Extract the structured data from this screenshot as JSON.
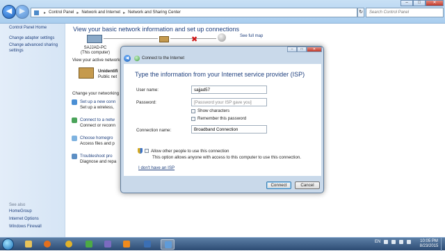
{
  "window": {
    "breadcrumb": [
      "Control Panel",
      "Network and Internet",
      "Network and Sharing Center"
    ],
    "search_placeholder": "Search Control Panel"
  },
  "left_nav": {
    "home": "Control Panel Home",
    "links": [
      "Change adapter settings",
      "Change advanced sharing settings"
    ],
    "see_also_header": "See also",
    "see_also": [
      "HomeGroup",
      "Internet Options",
      "Windows Firewall"
    ]
  },
  "main": {
    "title": "View your basic network information and set up connections",
    "computer_name": "SAJJAD-PC",
    "computer_sub": "(This computer)",
    "see_full_map": "See full map",
    "active_networks_header": "View your active networks",
    "active_network_name": "Unidentifi",
    "active_network_type": "Public net",
    "change_settings_header": "Change your networking se",
    "tasks": [
      {
        "link": "Set up a new conn",
        "desc": "Set up a wireless,"
      },
      {
        "link": "Connect to a netw",
        "desc": "Connect or reconn"
      },
      {
        "link": "Choose homegro",
        "desc": "Access files and p"
      },
      {
        "link": "Troubleshoot pro",
        "desc": "Diagnose and repa"
      }
    ]
  },
  "dialog": {
    "title": "Connect to the Internet",
    "heading": "Type the information from your Internet service provider (ISP)",
    "user_name_label": "User name:",
    "user_name_value": "sajjad57",
    "password_label": "Password:",
    "password_placeholder": "[Password your ISP gave you]",
    "show_characters": "Show characters",
    "remember_password": "Remember this password",
    "connection_name_label": "Connection name:",
    "connection_name_value": "Broadband Connection",
    "allow_others": "Allow other people to use this connection",
    "allow_desc": "This option allows anyone with access to this computer to use this connection.",
    "no_isp_link": "I don't have an ISP",
    "connect_button": "Connect",
    "cancel_button": "Cancel"
  },
  "taskbar": {
    "language": "EN",
    "time": "10:05 PM",
    "date": "8/23/2015"
  }
}
